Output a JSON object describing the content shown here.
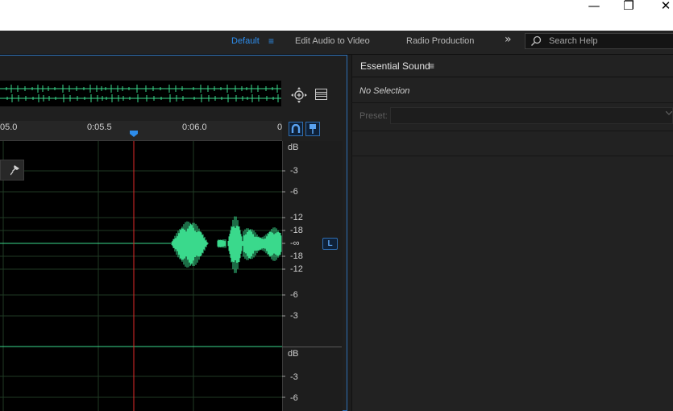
{
  "window": {
    "minimize_glyph": "—",
    "restore_glyph": "❐",
    "close_glyph": "✕"
  },
  "workspaces": {
    "active": "Default",
    "menu_glyph": "≡",
    "items": [
      "Edit Audio to Video",
      "Radio Production"
    ],
    "overflow_glyph": "»",
    "accent_color": "#2d8ceb"
  },
  "search": {
    "placeholder": "Search Help"
  },
  "editor": {
    "time_labels": [
      "05.0",
      "0:05.5",
      "0:06.0",
      "0"
    ],
    "playhead_color": "#e02a2a",
    "waveform_color": "#3ad98c",
    "channel_label": "L",
    "db_scale_top": [
      "dB",
      "-3",
      "-6",
      "-12",
      "-18",
      "-∞",
      "-18",
      "-12",
      "-6",
      "-3"
    ],
    "db_scale_bottom": [
      "dB",
      "-3",
      "-6"
    ]
  },
  "essential_sound": {
    "title": "Essential Sound",
    "menu_glyph": "≡",
    "status": "No Selection",
    "preset_label": "Preset:",
    "preset_value": ""
  }
}
